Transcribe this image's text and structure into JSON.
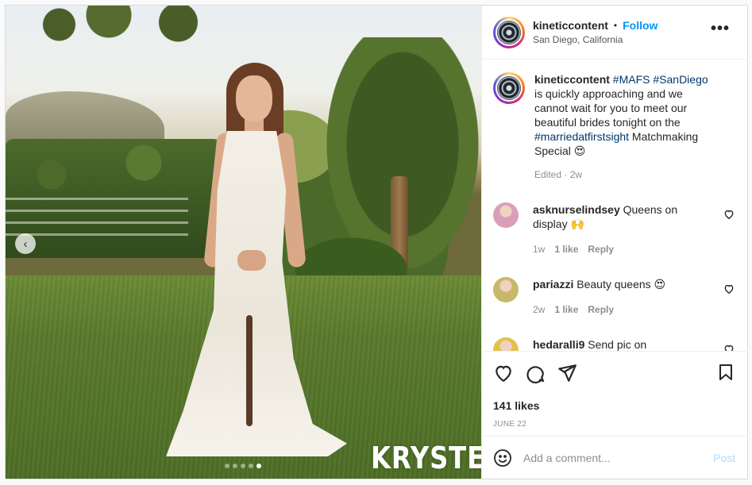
{
  "account": {
    "username": "kineticcontent",
    "separator": "•",
    "follow_label": "Follow",
    "location": "San Diego, California",
    "more_label": "•••"
  },
  "caption": {
    "username": "kineticcontent",
    "parts": [
      {
        "text": "#MAFS",
        "tag": true
      },
      {
        "text": " ",
        "tag": false
      },
      {
        "text": "#SanDiego",
        "tag": true
      },
      {
        "text": " is quickly approaching and we cannot wait for you to meet our beautiful brides tonight on the ",
        "tag": false
      },
      {
        "text": "#marriedatfirstsight",
        "tag": true
      },
      {
        "text": " Matchmaking Special 😍",
        "tag": false
      }
    ],
    "meta": "Edited · 2w"
  },
  "comments": [
    {
      "username": "asknurselindsey",
      "text": "Queens on display 🙌",
      "time": "1w",
      "likes": "1 like",
      "reply": "Reply",
      "avatar_color": "#d8a0b8"
    },
    {
      "username": "pariazzi",
      "text": "Beauty queens 😍",
      "time": "2w",
      "likes": "1 like",
      "reply": "Reply",
      "avatar_color": "#c9b86a"
    },
    {
      "username": "hedaralli9",
      "text": "Send pic on",
      "time": "",
      "likes": "",
      "reply": "",
      "avatar_color": "#e2c14c"
    }
  ],
  "media": {
    "watermark": "KRYSTEN",
    "slide_count": 5,
    "active_slide": 5,
    "prev_label": "‹"
  },
  "actions": {
    "likes": "141 likes",
    "date": "JUNE 22"
  },
  "composer": {
    "placeholder": "Add a comment...",
    "post_label": "Post",
    "emoji_icon": "smile-icon"
  }
}
